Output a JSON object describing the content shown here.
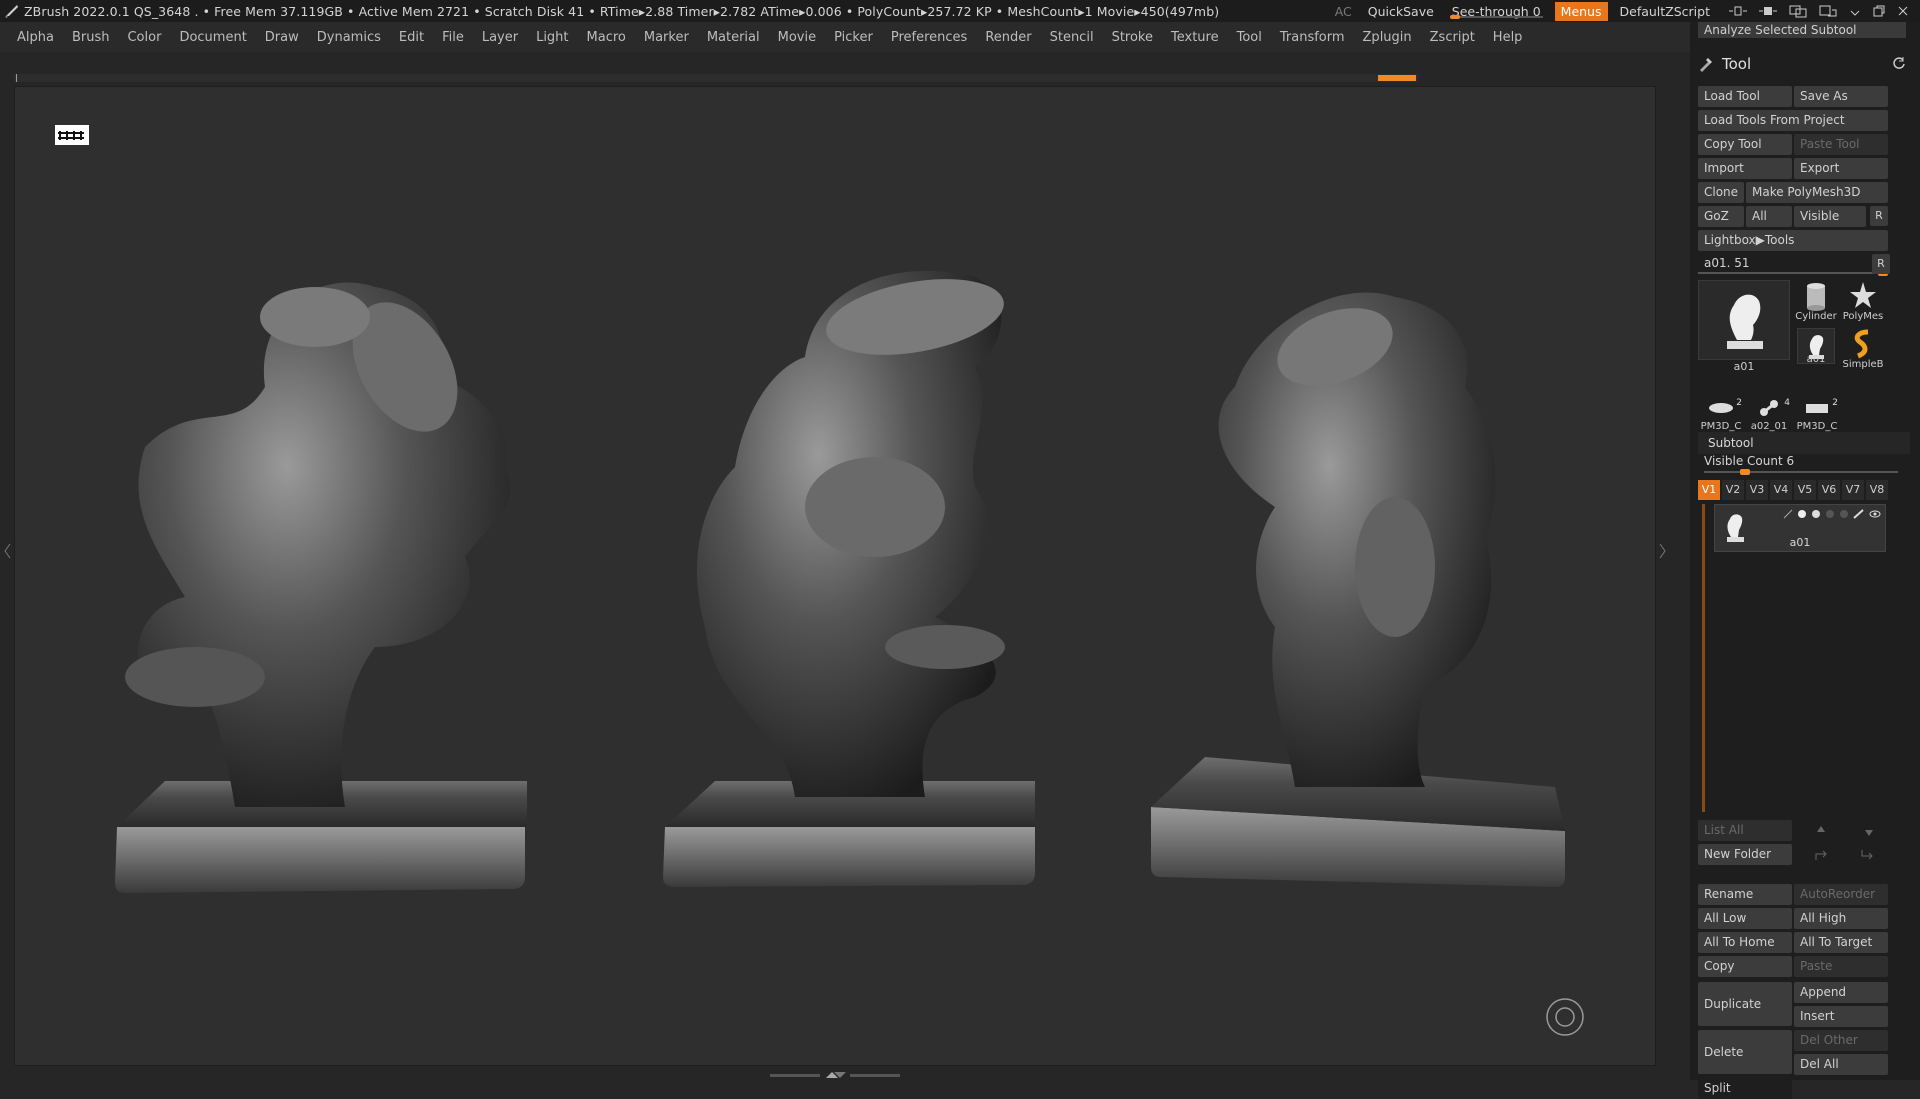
{
  "titlebar": {
    "status": "ZBrush 2022.0.1    QS_3648    . • Free Mem 37.119GB • Active Mem 2721 • Scratch Disk 41 •   RTime▸2.88 Timer▸2.782 ATime▸0.006 • PolyCount▸257.72 KP  • MeshCount▸1  Movie▸450(497mb)",
    "ac": "AC",
    "quicksave": "QuickSave",
    "seethrough": "See-through  0",
    "seethrough_value": 0,
    "menus": "Menus",
    "script": "DefaultZScript",
    "accent_color": "#e8761c"
  },
  "menubar": {
    "items": [
      "Alpha",
      "Brush",
      "Color",
      "Document",
      "Draw",
      "Dynamics",
      "Edit",
      "File",
      "Layer",
      "Light",
      "Macro",
      "Marker",
      "Material",
      "Movie",
      "Picker",
      "Preferences",
      "Render",
      "Stencil",
      "Stroke",
      "Texture",
      "Tool",
      "Transform",
      "Zplugin",
      "Zscript",
      "Help"
    ]
  },
  "panel": {
    "analyze": "Analyze Selected Subtool",
    "title": "Tool",
    "buttons": {
      "load_tool": "Load Tool",
      "save_as": "Save As",
      "load_from_project": "Load Tools From Project",
      "copy_tool": "Copy Tool",
      "paste_tool": "Paste Tool",
      "import": "Import",
      "export": "Export",
      "clone": "Clone",
      "make_polymesh": "Make PolyMesh3D",
      "goz": "GoZ",
      "all": "All",
      "visible": "Visible",
      "r": "R",
      "lightbox_tools": "Lightbox▶Tools"
    },
    "slider": {
      "label": "a01. 51",
      "r": "R"
    },
    "thumbs": {
      "main": "a01",
      "cylinder": "Cylinder",
      "polymesh": "PolyMes",
      "small_a01": "a01",
      "simpleb": "SimpleB",
      "pm3d_1": "PM3D_C",
      "pm3d_1_num": "2",
      "a02": "a02_01",
      "a02_num": "4",
      "pm3d_2": "PM3D_C",
      "pm3d_2_num": "2"
    },
    "subtool": {
      "header": "Subtool",
      "visible_count": "Visible Count 6",
      "versions": [
        "V1",
        "V2",
        "V3",
        "V4",
        "V5",
        "V6",
        "V7",
        "V8"
      ],
      "item_name": "a01"
    },
    "lower_buttons": {
      "list_all": "List All",
      "new_folder": "New Folder",
      "rename": "Rename",
      "autoreorder": "AutoReorder",
      "all_low": "All Low",
      "all_high": "All High",
      "all_to_home": "All To Home",
      "all_to_target": "All To Target",
      "copy": "Copy",
      "paste": "Paste",
      "duplicate": "Duplicate",
      "append": "Append",
      "insert": "Insert",
      "delete": "Delete",
      "del_other": "Del Other",
      "del_all": "Del All",
      "split": "Split"
    }
  }
}
